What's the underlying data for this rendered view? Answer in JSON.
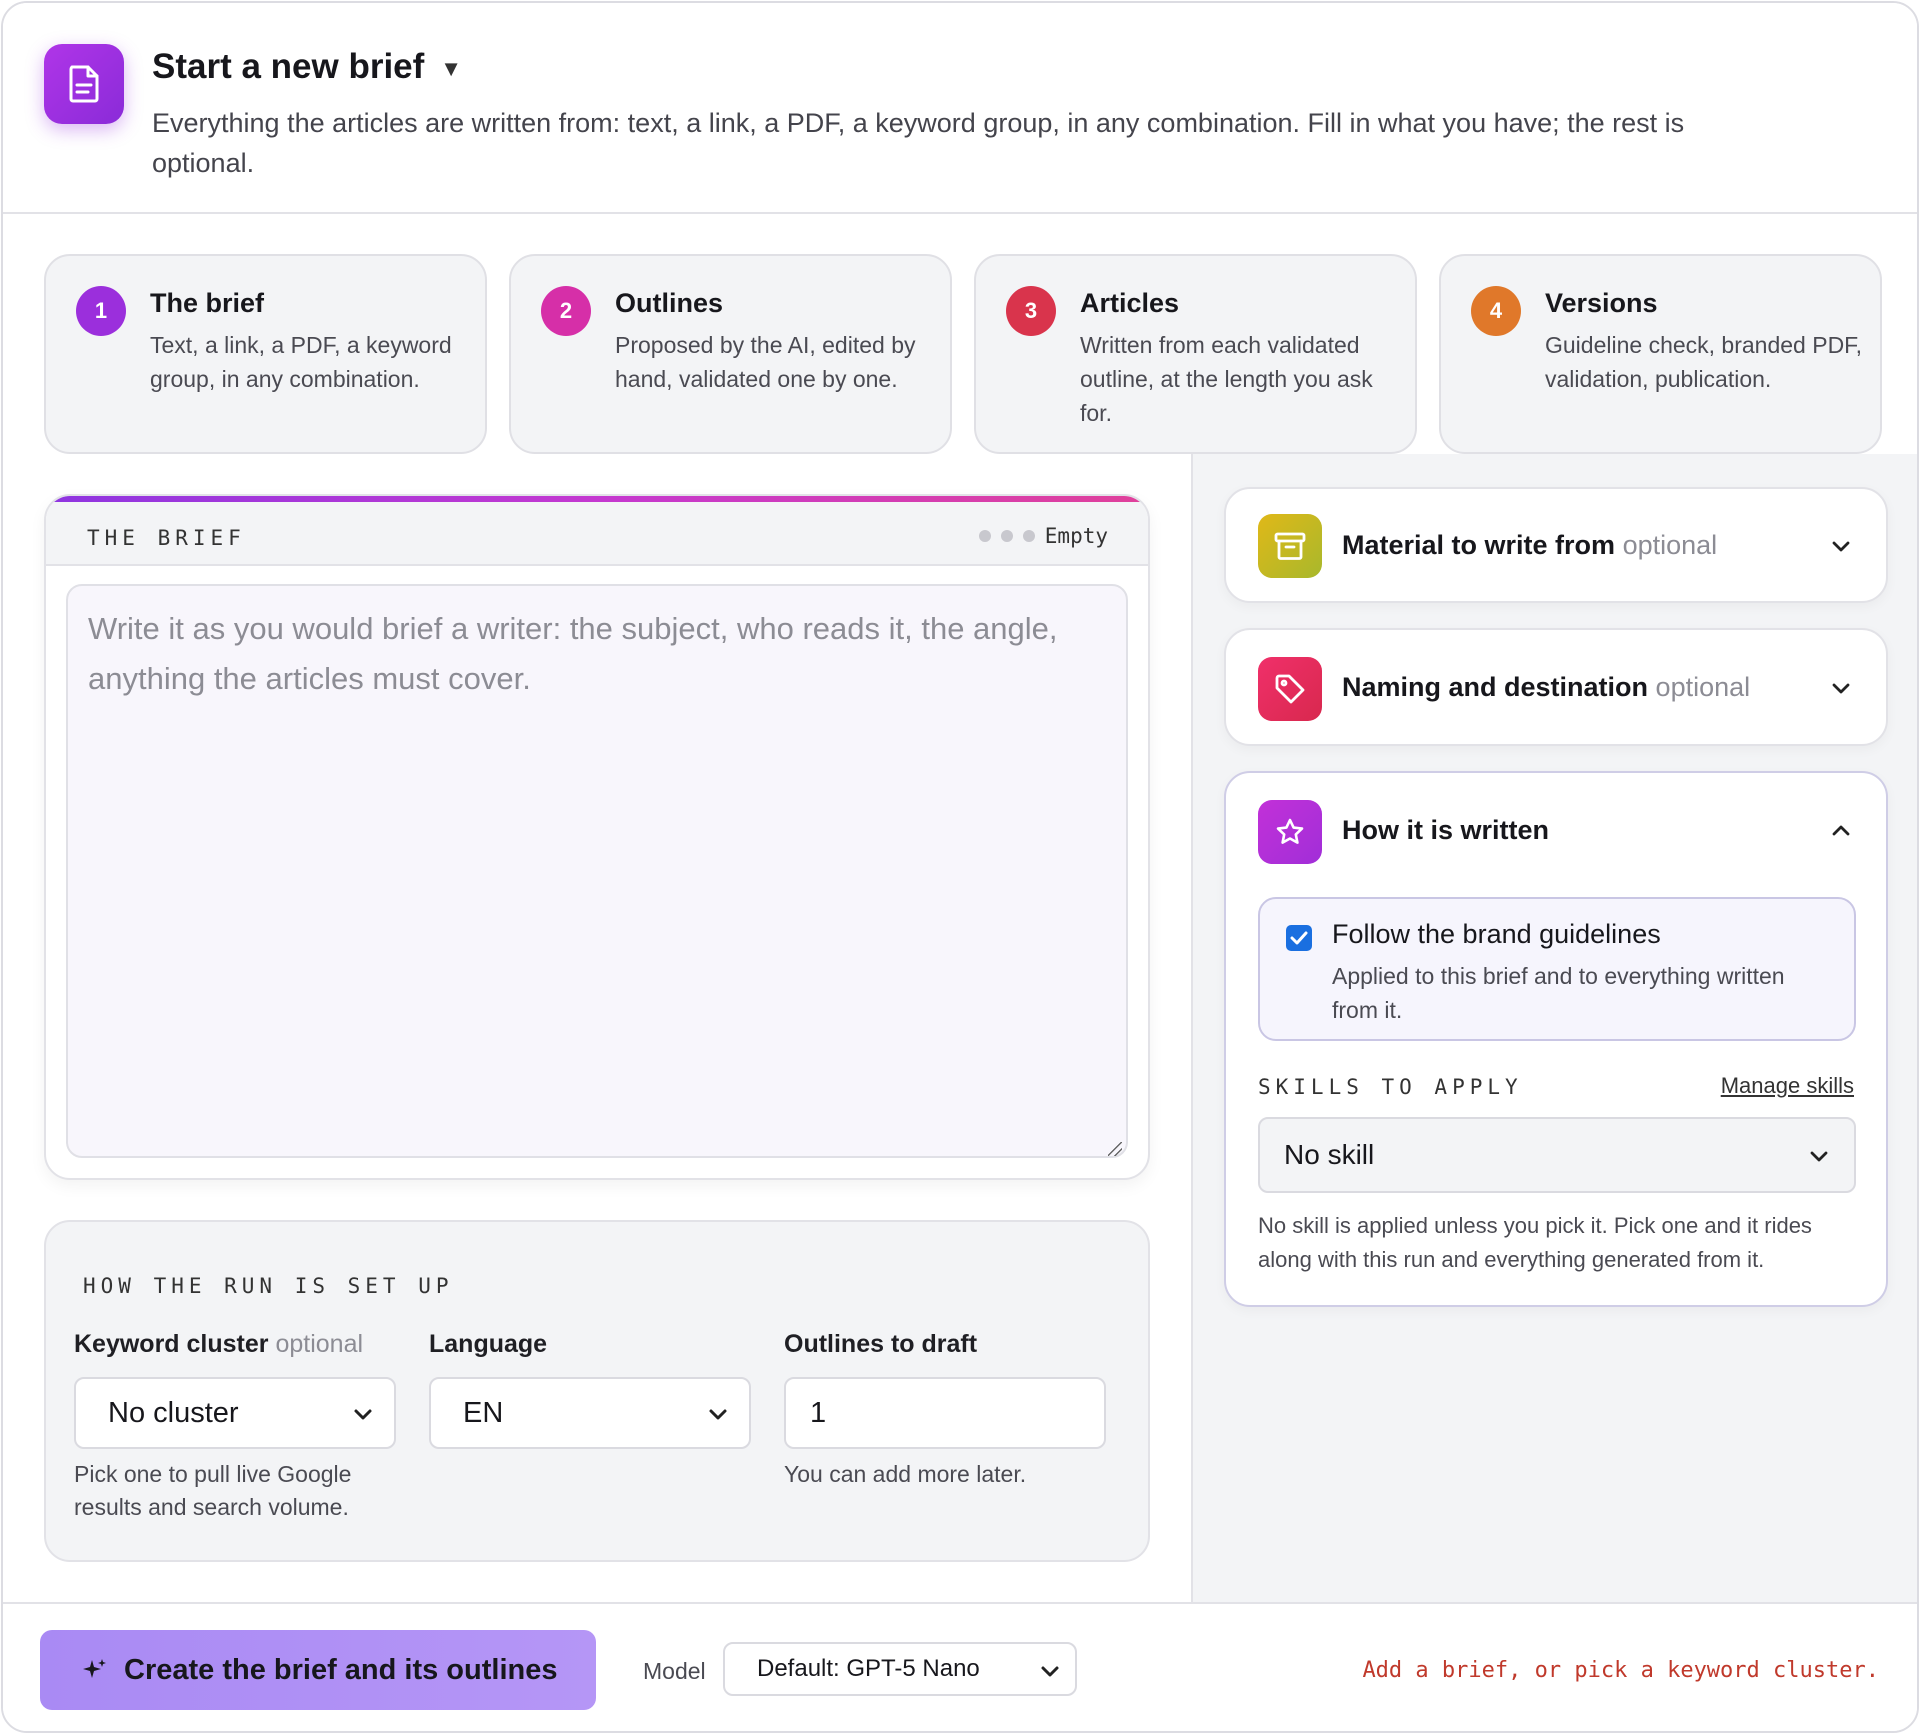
{
  "header": {
    "title": "Start a new brief",
    "description": "Everything the articles are written from: text, a link, a PDF, a keyword group, in any combination. Fill in what you have; the rest is optional."
  },
  "steps": [
    {
      "number": "1",
      "title": "The brief",
      "desc": "Text, a link, a PDF, a keyword group, in any combination.",
      "color": "#9b2fdc"
    },
    {
      "number": "2",
      "title": "Outlines",
      "desc": "Proposed by the AI, edited by hand, validated one by one.",
      "color": "#d62fa8"
    },
    {
      "number": "3",
      "title": "Articles",
      "desc": "Written from each validated outline, at the length you ask for.",
      "color": "#d9344c"
    },
    {
      "number": "4",
      "title": "Versions",
      "desc": "Guideline check, branded PDF, validation, publication.",
      "color": "#e0782a"
    }
  ],
  "brief": {
    "label": "THE BRIEF",
    "status": "Empty",
    "placeholder": "Write it as you would brief a writer: the subject, who reads it, the angle, anything the articles must cover."
  },
  "run": {
    "label": "HOW THE RUN IS SET UP",
    "cluster": {
      "label": "Keyword cluster",
      "optional": "optional",
      "value": "No cluster",
      "help": "Pick one to pull live Google results and search volume."
    },
    "language": {
      "label": "Language",
      "value": "EN"
    },
    "outlines": {
      "label": "Outlines to draft",
      "value": "1",
      "help": "You can add more later."
    }
  },
  "panels": {
    "material": {
      "title": "Material to write from",
      "optional": "optional"
    },
    "naming": {
      "title": "Naming and destination",
      "optional": "optional"
    },
    "written": {
      "title": "How it is written",
      "guidelines_title": "Follow the brand guidelines",
      "guidelines_desc": "Applied to this brief and to everything written from it.",
      "skills_label": "SKILLS TO APPLY",
      "manage_link": "Manage skills",
      "skill_value": "No skill",
      "skill_help": "No skill is applied unless you pick it. Pick one and it rides along with this run and everything generated from it."
    }
  },
  "footer": {
    "create_label": "Create the brief and its outlines",
    "model_label": "Model",
    "model_value": "Default: GPT-5 Nano",
    "hint": "Add a brief, or pick a keyword cluster."
  }
}
